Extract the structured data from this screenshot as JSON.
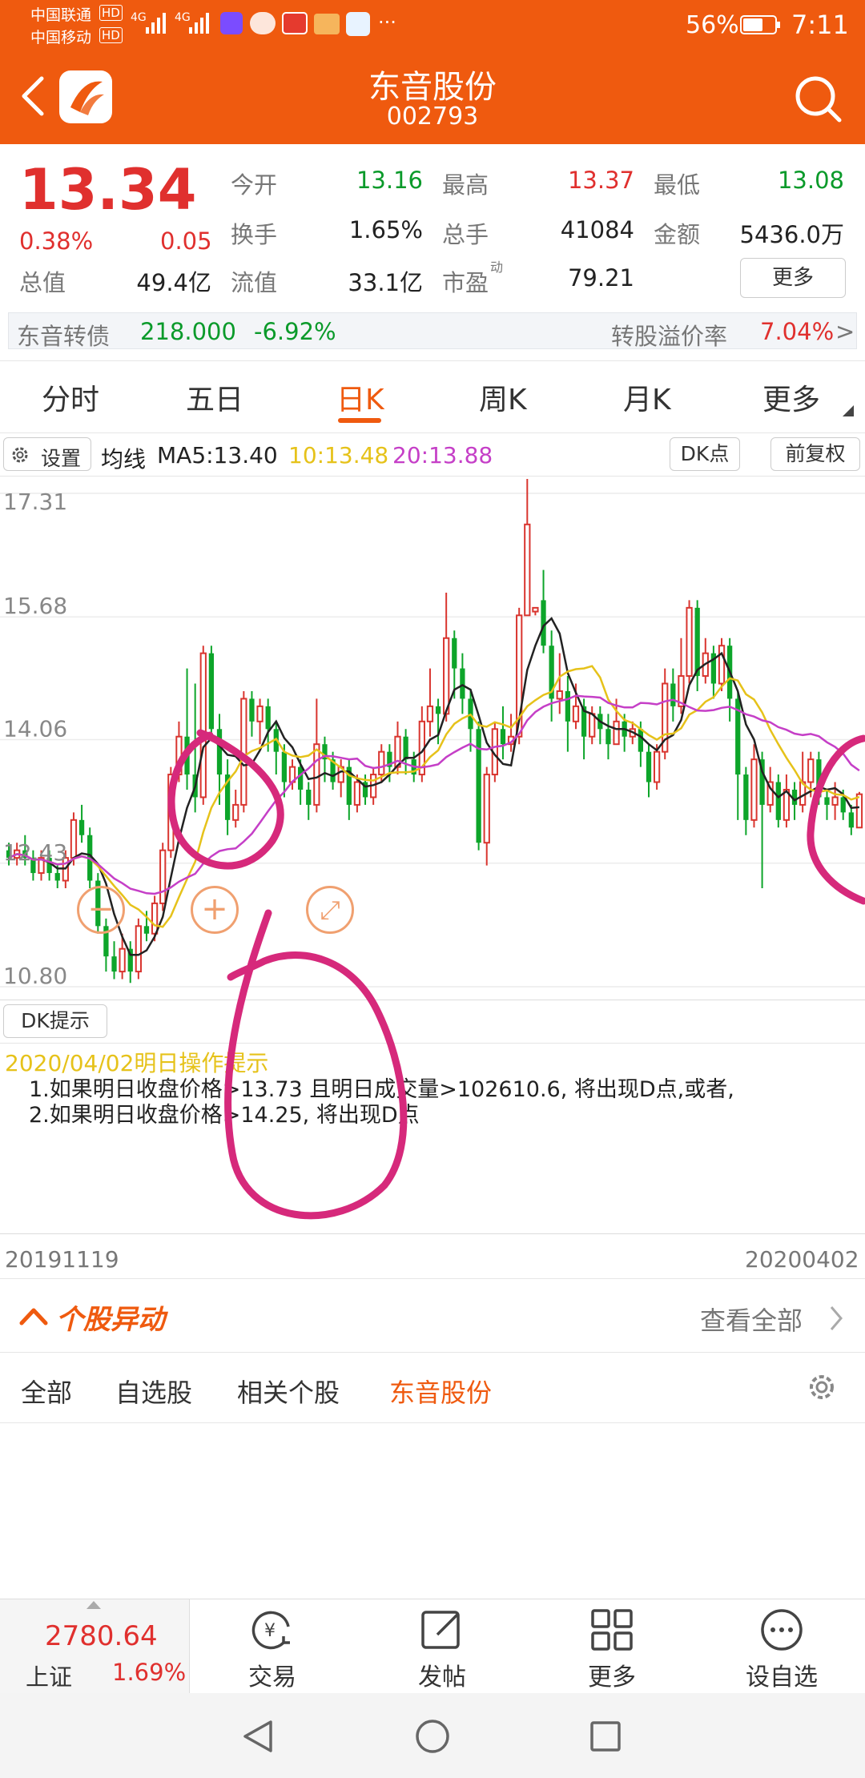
{
  "status_bar": {
    "carrier1": "中国联通",
    "carrier2": "中国移动",
    "hd": "HD",
    "net": "4G",
    "more": "···",
    "battery": "56%",
    "time": "7:11"
  },
  "header": {
    "title": "东音股份",
    "code": "002793"
  },
  "quote": {
    "price": "13.34",
    "change_pct": "0.38%",
    "change": "0.05",
    "fields": [
      {
        "label": "今开",
        "value": "13.16"
      },
      {
        "label": "最高",
        "value": "13.37"
      },
      {
        "label": "最低",
        "value": "13.08"
      },
      {
        "label": "换手",
        "value": "1.65%"
      },
      {
        "label": "总手",
        "value": "41084"
      },
      {
        "label": "金额",
        "value": "5436.0万"
      },
      {
        "label": "总值",
        "value": "49.4亿"
      },
      {
        "label": "流值",
        "value": "33.1亿"
      },
      {
        "label": "市盈",
        "value": "79.21"
      }
    ],
    "pe_sup": "动",
    "more_button": "更多"
  },
  "bond": {
    "name": "东音转债",
    "price": "218.000",
    "change": "-6.92%",
    "premium_label": "转股溢价率",
    "premium": "7.04%",
    "arrow": ">"
  },
  "tabs": [
    "分时",
    "五日",
    "日K",
    "周K",
    "月K",
    "更多"
  ],
  "chart_toolbar": {
    "settings": "设置",
    "ma_label": "均线",
    "ma5": "MA5:13.40",
    "ma10": "10:13.48",
    "ma20": "20:13.88",
    "dk_button": "DK点",
    "adjust_button": "前复权"
  },
  "chart_data": {
    "type": "candlestick",
    "y_ticks": [
      "17.31",
      "15.68",
      "14.06",
      "12.43",
      "10.80"
    ],
    "ylim": [
      10.8,
      17.31
    ],
    "x_start": "20191119",
    "x_end": "20200402",
    "colors": {
      "up": "#d9352f",
      "down": "#0da52a",
      "ma5": "#222222",
      "ma10": "#e6c21a",
      "ma20": "#c53fc7"
    },
    "candles": [
      [
        12.6,
        12.5,
        12.7,
        12.4
      ],
      [
        12.5,
        12.6,
        12.7,
        12.4
      ],
      [
        12.6,
        12.5,
        12.8,
        12.4
      ],
      [
        12.5,
        12.3,
        12.6,
        12.2
      ],
      [
        12.3,
        12.5,
        12.6,
        12.2
      ],
      [
        12.5,
        12.3,
        12.6,
        12.2
      ],
      [
        12.3,
        12.2,
        12.4,
        12.1
      ],
      [
        12.2,
        12.5,
        12.6,
        12.1
      ],
      [
        12.5,
        13.0,
        13.1,
        12.4
      ],
      [
        13.0,
        12.8,
        13.2,
        12.7
      ],
      [
        12.8,
        12.2,
        12.9,
        12.1
      ],
      [
        12.2,
        11.6,
        12.3,
        11.5
      ],
      [
        11.6,
        11.2,
        11.7,
        11.0
      ],
      [
        11.2,
        11.0,
        11.4,
        10.9
      ],
      [
        11.0,
        11.3,
        11.5,
        10.9
      ],
      [
        11.3,
        11.0,
        11.4,
        10.85
      ],
      [
        11.0,
        11.6,
        11.7,
        10.9
      ],
      [
        11.6,
        11.5,
        11.8,
        11.4
      ],
      [
        11.5,
        11.9,
        12.0,
        11.4
      ],
      [
        11.9,
        12.6,
        12.7,
        11.8
      ],
      [
        12.6,
        13.6,
        13.7,
        12.5
      ],
      [
        13.6,
        14.1,
        14.3,
        13.5
      ],
      [
        14.1,
        13.6,
        15.0,
        13.4
      ],
      [
        13.6,
        13.3,
        14.8,
        13.1
      ],
      [
        13.3,
        15.2,
        15.3,
        13.2
      ],
      [
        15.2,
        14.2,
        15.3,
        14.1
      ],
      [
        14.2,
        13.6,
        14.4,
        13.2
      ],
      [
        13.6,
        13.0,
        13.8,
        12.8
      ],
      [
        13.0,
        13.2,
        13.4,
        12.9
      ],
      [
        13.2,
        14.6,
        14.7,
        13.1
      ],
      [
        14.6,
        14.3,
        14.7,
        14.1
      ],
      [
        14.3,
        14.5,
        14.6,
        14.0
      ],
      [
        14.5,
        14.2,
        14.6,
        13.9
      ],
      [
        14.2,
        13.9,
        14.3,
        13.6
      ],
      [
        13.9,
        13.5,
        14.0,
        13.3
      ],
      [
        13.5,
        13.7,
        13.8,
        13.4
      ],
      [
        13.7,
        13.4,
        13.8,
        13.2
      ],
      [
        13.4,
        13.2,
        13.5,
        13.0
      ],
      [
        13.2,
        14.0,
        14.6,
        13.1
      ],
      [
        14.0,
        13.8,
        14.1,
        13.5
      ],
      [
        13.8,
        13.5,
        13.9,
        13.4
      ],
      [
        13.5,
        13.7,
        13.8,
        13.3
      ],
      [
        13.7,
        13.2,
        13.8,
        13.0
      ],
      [
        13.2,
        13.5,
        13.6,
        13.1
      ],
      [
        13.5,
        13.3,
        13.6,
        13.2
      ],
      [
        13.3,
        13.6,
        13.7,
        13.2
      ],
      [
        13.6,
        13.9,
        14.0,
        13.5
      ],
      [
        13.9,
        13.7,
        14.0,
        13.5
      ],
      [
        13.7,
        14.1,
        14.3,
        13.6
      ],
      [
        14.1,
        13.8,
        14.2,
        13.6
      ],
      [
        13.8,
        13.6,
        13.9,
        13.5
      ],
      [
        13.6,
        14.3,
        14.5,
        13.5
      ],
      [
        14.3,
        14.5,
        15.0,
        14.1
      ],
      [
        14.5,
        14.4,
        14.6,
        14.0
      ],
      [
        14.4,
        15.4,
        16.0,
        14.3
      ],
      [
        15.4,
        15.0,
        15.5,
        14.6
      ],
      [
        15.0,
        14.6,
        15.2,
        14.4
      ],
      [
        14.6,
        14.2,
        14.7,
        13.9
      ],
      [
        14.2,
        12.7,
        14.3,
        12.6
      ],
      [
        12.7,
        13.6,
        13.7,
        12.4
      ],
      [
        13.6,
        14.2,
        14.3,
        13.5
      ],
      [
        14.2,
        14.0,
        14.5,
        13.8
      ],
      [
        14.0,
        14.1,
        14.4,
        13.9
      ],
      [
        14.1,
        15.7,
        15.8,
        14.0
      ],
      [
        15.7,
        16.9,
        17.5,
        15.7
      ],
      [
        15.75,
        15.8,
        15.8,
        15.7
      ],
      [
        15.9,
        15.3,
        16.3,
        15.2
      ],
      [
        15.3,
        14.6,
        15.5,
        14.3
      ],
      [
        14.6,
        14.7,
        15.2,
        14.4
      ],
      [
        14.7,
        14.3,
        14.9,
        13.9
      ],
      [
        14.3,
        14.5,
        14.8,
        14.2
      ],
      [
        14.5,
        14.1,
        14.6,
        13.8
      ],
      [
        14.1,
        14.4,
        14.5,
        14.0
      ],
      [
        14.4,
        14.2,
        14.5,
        14.0
      ],
      [
        14.2,
        14.0,
        14.4,
        13.8
      ],
      [
        14.0,
        14.3,
        14.6,
        14.0
      ],
      [
        14.3,
        14.1,
        14.4,
        13.9
      ],
      [
        14.1,
        14.2,
        14.3,
        14.0
      ],
      [
        14.2,
        13.9,
        14.3,
        13.7
      ],
      [
        13.9,
        13.5,
        14.0,
        13.3
      ],
      [
        13.5,
        13.9,
        14.0,
        13.4
      ],
      [
        13.9,
        14.8,
        15.0,
        13.8
      ],
      [
        14.8,
        14.5,
        15.0,
        14.3
      ],
      [
        14.5,
        14.9,
        15.4,
        14.4
      ],
      [
        14.9,
        15.8,
        15.9,
        14.8
      ],
      [
        15.8,
        14.9,
        15.9,
        14.7
      ],
      [
        14.9,
        15.2,
        15.4,
        14.8
      ],
      [
        15.2,
        14.8,
        15.3,
        14.6
      ],
      [
        14.8,
        15.3,
        15.4,
        14.7
      ],
      [
        15.3,
        14.6,
        15.4,
        14.3
      ],
      [
        14.6,
        13.6,
        14.7,
        13.0
      ],
      [
        13.6,
        13.0,
        13.7,
        12.8
      ],
      [
        13.0,
        13.8,
        14.0,
        12.9
      ],
      [
        13.8,
        13.2,
        13.9,
        12.1
      ],
      [
        13.2,
        13.5,
        13.7,
        13.1
      ],
      [
        13.5,
        13.0,
        13.6,
        12.9
      ],
      [
        13.0,
        13.4,
        13.6,
        12.9
      ],
      [
        13.4,
        13.2,
        13.5,
        13.0
      ],
      [
        13.2,
        13.5,
        13.9,
        13.1
      ],
      [
        13.5,
        13.8,
        13.9,
        13.3
      ],
      [
        13.8,
        13.3,
        13.9,
        13.2
      ],
      [
        13.3,
        13.2,
        13.4,
        13.0
      ],
      [
        13.2,
        13.3,
        13.5,
        13.0
      ],
      [
        13.3,
        13.1,
        13.4,
        13.0
      ],
      [
        13.1,
        12.9,
        13.2,
        12.8
      ],
      [
        12.9,
        13.34,
        13.37,
        13.08
      ]
    ]
  },
  "chart_controls": {
    "minus": "−",
    "plus": "+",
    "expand": "⤢"
  },
  "dk": {
    "button": "DK提示",
    "date_line": "2020/04/02明日操作提示",
    "line1": "1.如果明日收盘价格>13.73 且明日成交量>102610.6, 将出现D点,或者,",
    "line2": "2.如果明日收盘价格>14.25, 将出现D点"
  },
  "date_range": {
    "start": "20191119",
    "end": "20200402"
  },
  "anomaly": {
    "title": "个股异动",
    "view_all": "查看全部",
    "filters": [
      "全部",
      "自选股",
      "相关个股",
      "东音股份"
    ]
  },
  "bottom_nav": {
    "index_value": "2780.64",
    "index_name": "上证",
    "index_change": "1.69%",
    "items": [
      "交易",
      "发帖",
      "更多",
      "设自选"
    ]
  }
}
